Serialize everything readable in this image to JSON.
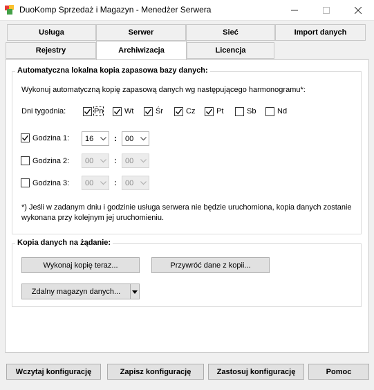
{
  "window": {
    "title": "DuoKomp Sprzedaż i Magazyn - Menedżer Serwera"
  },
  "tabs_row1": [
    "Usługa",
    "Serwer",
    "Sieć",
    "Import danych"
  ],
  "tabs_row2": [
    "Rejestry",
    "Archiwizacja",
    "Licencja"
  ],
  "active_tab": "Archiwizacja",
  "auto_backup": {
    "legend": "Automatyczna lokalna kopia zapasowa bazy danych:",
    "intro": "Wykonuj automatyczną kopię zapasową danych wg następującego harmonogramu*:",
    "days_label": "Dni tygodnia:",
    "days": [
      {
        "label": "Pn",
        "checked": true
      },
      {
        "label": "Wt",
        "checked": true
      },
      {
        "label": "Śr",
        "checked": true
      },
      {
        "label": "Cz",
        "checked": true
      },
      {
        "label": "Pt",
        "checked": true
      },
      {
        "label": "Sb",
        "checked": false
      },
      {
        "label": "Nd",
        "checked": false
      }
    ],
    "times": [
      {
        "label": "Godzina 1:",
        "checked": true,
        "hour": "16",
        "minute": "00",
        "enabled": true
      },
      {
        "label": "Godzina 2:",
        "checked": false,
        "hour": "00",
        "minute": "00",
        "enabled": false
      },
      {
        "label": "Godzina 3:",
        "checked": false,
        "hour": "00",
        "minute": "00",
        "enabled": false
      }
    ],
    "time_separator": ":",
    "footnote_line1": "*) Jeśli w zadanym dniu i godzinie usługa serwera nie będzie uruchomiona, kopia danych zostanie",
    "footnote_line2": "wykonana przy kolejnym jej uruchomieniu."
  },
  "on_demand": {
    "legend": "Kopia danych na żądanie:",
    "backup_now": "Wykonaj kopię teraz...",
    "restore": "Przywróć dane z kopii...",
    "remote_storage": "Zdalny magazyn danych..."
  },
  "bottom_buttons": {
    "load": "Wczytaj konfigurację",
    "save": "Zapisz konfigurację",
    "apply": "Zastosuj konfigurację",
    "help": "Pomoc"
  }
}
